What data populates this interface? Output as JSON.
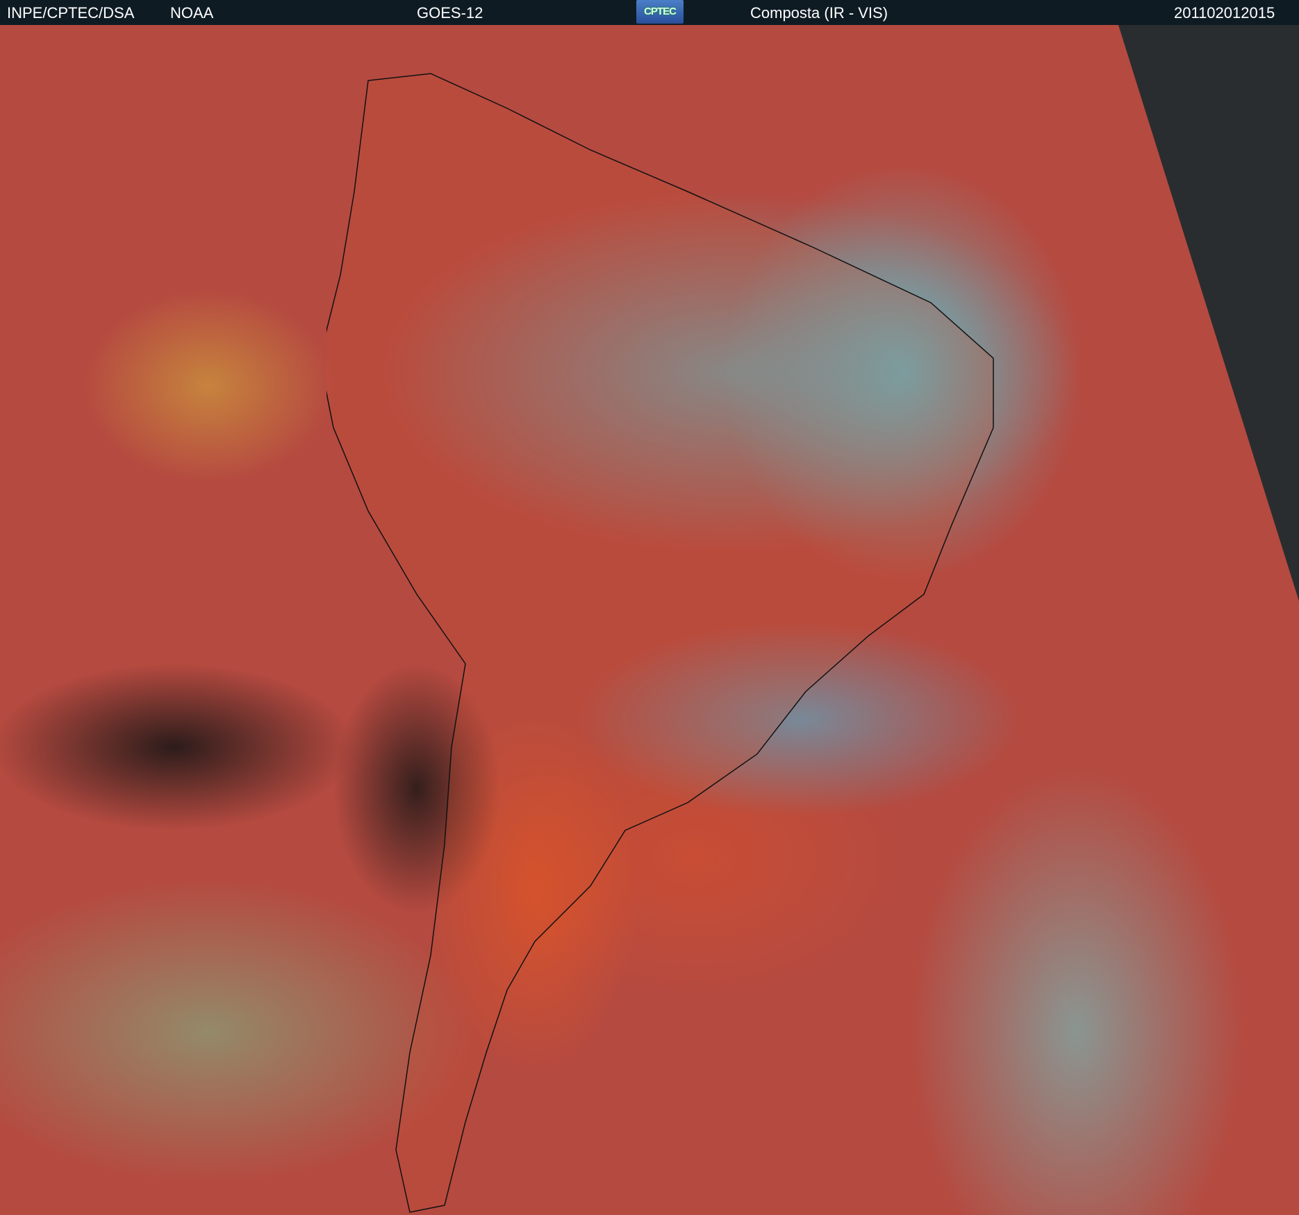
{
  "header": {
    "agency": "INPE/CPTEC/DSA",
    "source": "NOAA",
    "satellite": "GOES-12",
    "logo_text": "CPTEC",
    "product": "Composta (IR - VIS)",
    "timestamp": "201102012015"
  },
  "colors": {
    "header_bg": "#0f1b23",
    "ocean_clear": "#b54a40",
    "cloud_high": "#40e0f8",
    "space": "#2a2d30"
  }
}
